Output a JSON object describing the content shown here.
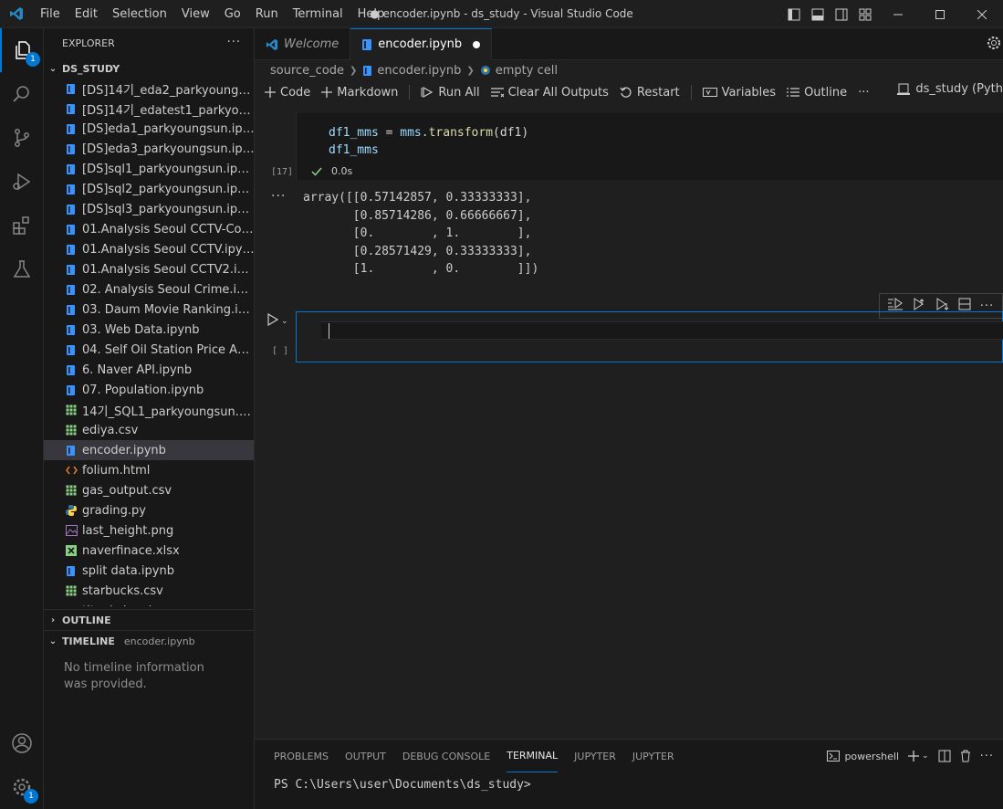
{
  "app": {
    "window_title": "● encoder.ipynb - ds_study - Visual Studio Code",
    "menu": [
      "File",
      "Edit",
      "Selection",
      "View",
      "Go",
      "Run",
      "Terminal",
      "Help"
    ]
  },
  "activity": {
    "explorer_badge": "1",
    "settings_badge": "1"
  },
  "sidebar": {
    "title": "EXPLORER",
    "folder": "DS_STUDY",
    "files": [
      {
        "name": "[DS]14기_eda2_parkyoungsun.i...",
        "icon": "notebook-icon"
      },
      {
        "name": "[DS]14기_edatest1_parkyoungs...",
        "icon": "notebook-icon"
      },
      {
        "name": "[DS]eda1_parkyoungsun.ipynb",
        "icon": "notebook-icon"
      },
      {
        "name": "[DS]eda3_parkyoungsun.ipynb",
        "icon": "notebook-icon"
      },
      {
        "name": "[DS]sql1_parkyoungsun.ipynb",
        "icon": "notebook-icon"
      },
      {
        "name": "[DS]sql2_parkyoungsun.ipynb",
        "icon": "notebook-icon"
      },
      {
        "name": "[DS]sql3_parkyoungsun.ipynb",
        "icon": "notebook-icon"
      },
      {
        "name": "01.Analysis Seoul CCTV-Copy1....",
        "icon": "notebook-icon"
      },
      {
        "name": "01.Analysis Seoul CCTV.ipynb",
        "icon": "notebook-icon"
      },
      {
        "name": "01.Analysis Seoul CCTV2.ipynb",
        "icon": "notebook-icon"
      },
      {
        "name": "02. Analysis Seoul Crime.ipynb",
        "icon": "notebook-icon"
      },
      {
        "name": "03. Daum Movie Ranking.ipynb",
        "icon": "notebook-icon"
      },
      {
        "name": "03. Web Data.ipynb",
        "icon": "notebook-icon"
      },
      {
        "name": "04. Self Oil Station Price Analys...",
        "icon": "notebook-icon"
      },
      {
        "name": "6. Naver API.ipynb",
        "icon": "notebook-icon"
      },
      {
        "name": "07. Population.ipynb",
        "icon": "notebook-icon"
      },
      {
        "name": "14기_SQL1_parkyoungsun.csv.c...",
        "icon": "csv-icon"
      },
      {
        "name": "ediya.csv",
        "icon": "csv-icon"
      },
      {
        "name": "encoder.ipynb",
        "icon": "notebook-icon",
        "selected": true
      },
      {
        "name": "folium.html",
        "icon": "html-icon"
      },
      {
        "name": "gas_output.csv",
        "icon": "csv-icon"
      },
      {
        "name": "grading.py",
        "icon": "python-icon"
      },
      {
        "name": "last_height.png",
        "icon": "image-icon"
      },
      {
        "name": "naverfinace.xlsx",
        "icon": "excel-icon"
      },
      {
        "name": "split data.ipynb",
        "icon": "notebook-icon"
      },
      {
        "name": "starbucks.csv",
        "icon": "csv-icon"
      },
      {
        "name": "titanic.ipynb",
        "icon": "notebook-icon"
      }
    ],
    "outline_title": "OUTLINE",
    "timeline_title": "TIMELINE",
    "timeline_file": "encoder.ipynb",
    "timeline_message": "No timeline information was provided."
  },
  "tabs": [
    {
      "label": "Welcome",
      "active": false
    },
    {
      "label": "encoder.ipynb",
      "active": true
    }
  ],
  "breadcrumb": [
    "source_code",
    "encoder.ipynb",
    "empty cell"
  ],
  "toolbar": {
    "code": "Code",
    "markdown": "Markdown",
    "run_all": "Run All",
    "clear_outputs": "Clear All Outputs",
    "restart": "Restart",
    "variables": "Variables",
    "outline": "Outline",
    "kernel": "ds_study (Pyth"
  },
  "cell1": {
    "line1": {
      "var": "df1_mms",
      "op": " = ",
      "obj": "mms.",
      "fn": "transform",
      "args": "(df1)"
    },
    "line2": "df1_mms",
    "exec_count": "[17]",
    "duration": "0.0s",
    "output": "array([[0.57142857, 0.33333333],\n       [0.85714286, 0.66666667],\n       [0.        , 1.        ],\n       [0.28571429, 0.33333333],\n       [1.        , 0.        ]])"
  },
  "cell2": {
    "exec_count": "[ ]"
  },
  "panel": {
    "tabs": [
      "PROBLEMS",
      "OUTPUT",
      "DEBUG CONSOLE",
      "TERMINAL",
      "JUPYTER",
      "JUPYTER"
    ],
    "active_tab": 3,
    "shell": "powershell",
    "prompt": "PS C:\\Users\\user\\Documents\\ds_study>"
  }
}
